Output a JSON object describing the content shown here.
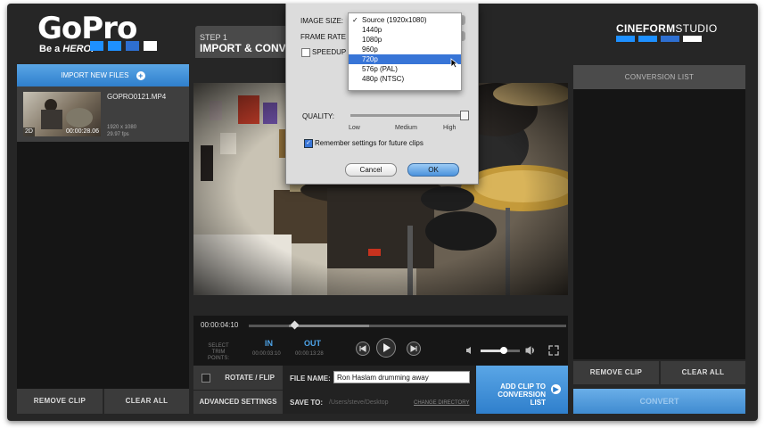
{
  "brand": {
    "logo": "GoPro",
    "tagline_prefix": "Be a ",
    "tagline_emphasis": "HERO.",
    "swatch_colors": [
      "#1e90ff",
      "#1e90ff",
      "#2e6fd0",
      "#ffffff"
    ],
    "studio_bold": "CINEFORM",
    "studio_light": "STUDIO",
    "studio_swatch_colors": [
      "#1e90ff",
      "#1e90ff",
      "#2e6fd0",
      "#ffffff"
    ]
  },
  "step": {
    "number": "STEP 1",
    "title": "IMPORT & CONVER"
  },
  "left_panel": {
    "import_label": "IMPORT NEW FILES",
    "import_icon": "plus-circle-icon",
    "clip": {
      "name": "GOPRO0121.MP4",
      "resolution": "1920 x 1080",
      "fps": "29.97 fps",
      "badge": "2D",
      "duration": "00:00:28.06"
    },
    "remove_label": "REMOVE CLIP",
    "clear_label": "CLEAR ALL"
  },
  "dialog": {
    "image_size_label": "IMAGE SIZE:",
    "frame_rate_label": "FRAME RATE",
    "speedup_label": "SPEEDUP",
    "speedup_checked": false,
    "options": [
      "Source (1920x1080)",
      "1440p",
      "1080p",
      "960p",
      "720p",
      "576p (PAL)",
      "480p (NTSC)"
    ],
    "checked_option": "Source (1920x1080)",
    "highlighted_option": "720p",
    "quality_label": "QUALITY:",
    "quality_levels": [
      "Low",
      "Medium",
      "High"
    ],
    "quality_value": "High",
    "remember_label": "Remember settings for future clips",
    "remember_checked": true,
    "cancel_label": "Cancel",
    "ok_label": "OK"
  },
  "transport": {
    "current_time": "00:00:04:10",
    "select_label": "SELECT\nTRIM POINTS:",
    "in_label": "IN",
    "in_time": "00:00:03:10",
    "out_label": "OUT",
    "out_time": "00:00:13:28",
    "volume_level": 0.6
  },
  "bottom": {
    "rotate_label": "ROTATE / FLIP",
    "advanced_label": "ADVANCED SETTINGS",
    "file_name_label": "FILE NAME:",
    "file_name_value": "Ron Haslam drumming away",
    "save_to_label": "SAVE TO:",
    "save_to_path": "/Users/steve/Desktop",
    "change_dir_label": "CHANGE DIRECTORY",
    "add_clip_label_1": "ADD CLIP TO",
    "add_clip_label_2": "CONVERSION LIST"
  },
  "right_panel": {
    "header": "CONVERSION LIST",
    "remove_label": "REMOVE CLIP",
    "clear_label": "CLEAR ALL",
    "convert_label": "CONVERT"
  }
}
